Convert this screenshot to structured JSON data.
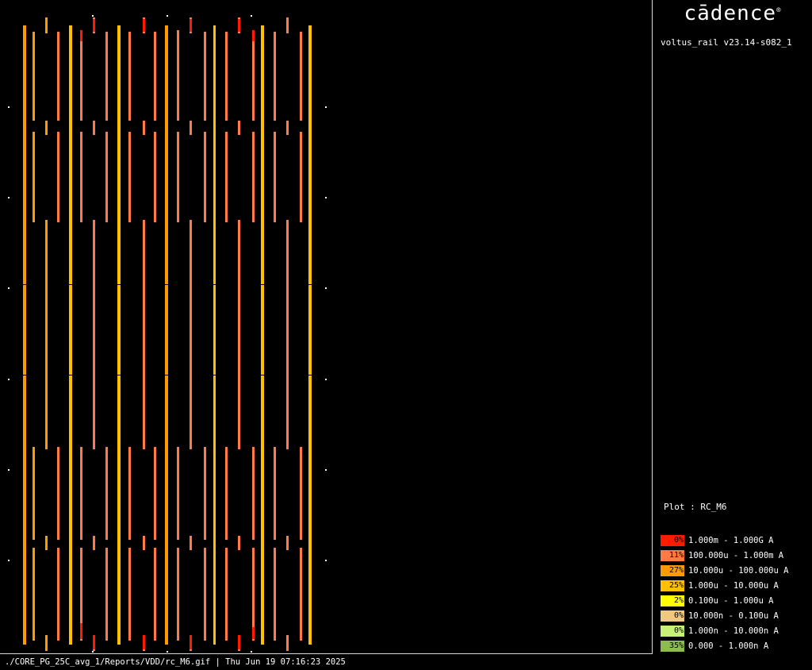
{
  "sidebar": {
    "logo_text": "cādence",
    "logo_mark": "®",
    "version": "voltus_rail v23.14-s082_1",
    "plot_label": "Plot : RC_M6"
  },
  "legend": [
    {
      "percent": "0%",
      "range": "1.000m - 1.000G A",
      "color": "#ff1a00"
    },
    {
      "percent": "11%",
      "range": "100.000u - 1.000m A",
      "color": "#ff7a45"
    },
    {
      "percent": "27%",
      "range": "10.000u - 100.000u A",
      "color": "#ff9a00"
    },
    {
      "percent": "25%",
      "range": "1.000u - 10.000u A",
      "color": "#ffc000"
    },
    {
      "percent": "2%",
      "range": "0.100u - 1.000u A",
      "color": "#ffff00"
    },
    {
      "percent": "0%",
      "range": "10.000n - 0.100u A",
      "color": "#f0c880"
    },
    {
      "percent": "0%",
      "range": "1.000n - 10.000n A",
      "color": "#c8f078"
    },
    {
      "percent": "35%",
      "range": "0.000 - 1.000n A",
      "color": "#8cbc50"
    }
  ],
  "status_bar": "./CORE_PG_25C_avg_1/Reports/VDD/rc_M6.gif | Thu Jun 19 07:16:23 2025",
  "layout_colors": {
    "orange": "#ff9a00",
    "salmon": "#ff7a45",
    "gold": "#ffc000",
    "red": "#ff1a00",
    "yellow": "#ffff00",
    "dark_orange": "#e08000"
  }
}
